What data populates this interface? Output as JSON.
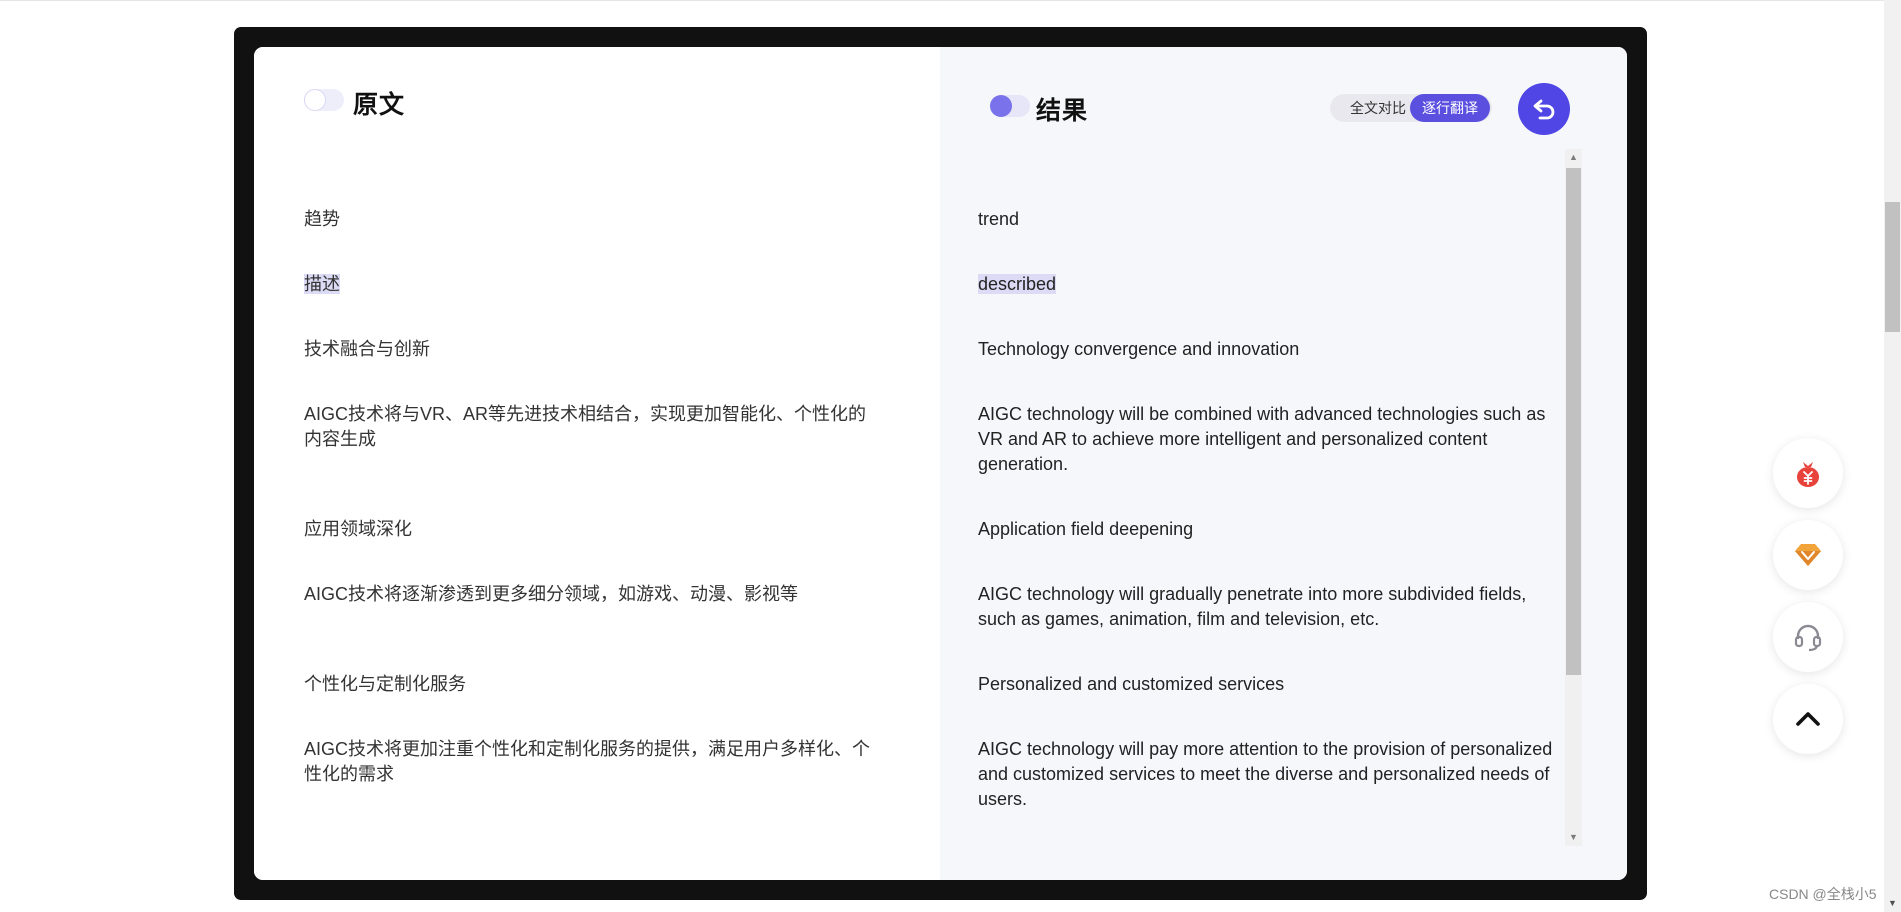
{
  "left_pane": {
    "title": "原文",
    "toggle_on": false
  },
  "right_pane": {
    "title": "结果",
    "toggle_on": true
  },
  "mode_switch": {
    "options": [
      "全文对比",
      "逐行翻译"
    ],
    "selected": "逐行翻译"
  },
  "back_button": {
    "icon": "undo-arrow-icon"
  },
  "rows": [
    {
      "source": "趋势",
      "translation": "trend",
      "highlighted": false
    },
    {
      "source": "描述",
      "translation": "described",
      "highlighted": true
    },
    {
      "source": "技术融合与创新",
      "translation": "Technology convergence and innovation",
      "highlighted": false
    },
    {
      "source": "AIGC技术将与VR、AR等先进技术相结合，实现更加智能化、个性化的内容生成",
      "translation": "AIGC technology will be combined with advanced technologies such as VR and AR to achieve more intelligent and personalized content generation.",
      "highlighted": false
    },
    {
      "source": "应用领域深化",
      "translation": "Application field deepening",
      "highlighted": false
    },
    {
      "source": "AIGC技术将逐渐渗透到更多细分领域，如游戏、动漫、影视等",
      "translation": "AIGC technology will gradually penetrate into more subdivided fields, such as games, animation, film and television, etc.",
      "highlighted": false
    },
    {
      "source": "个性化与定制化服务",
      "translation": "Personalized and customized services",
      "highlighted": false
    },
    {
      "source": "AIGC技术将更加注重个性化和定制化服务的提供，满足用户多样化、个性化的需求",
      "translation": "AIGC technology will pay more attention to the provision of personalized and customized services to meet the diverse and personalized needs of users.",
      "highlighted": false
    }
  ],
  "floating_buttons": [
    "money-bag-icon",
    "diamond-icon",
    "headset-icon",
    "chevron-up-icon"
  ],
  "watermark": "CSDN @全栈小5",
  "colors": {
    "accent": "#4f46e5",
    "toggle_on": "#7a72ea",
    "highlight": "#dcdbf5"
  }
}
